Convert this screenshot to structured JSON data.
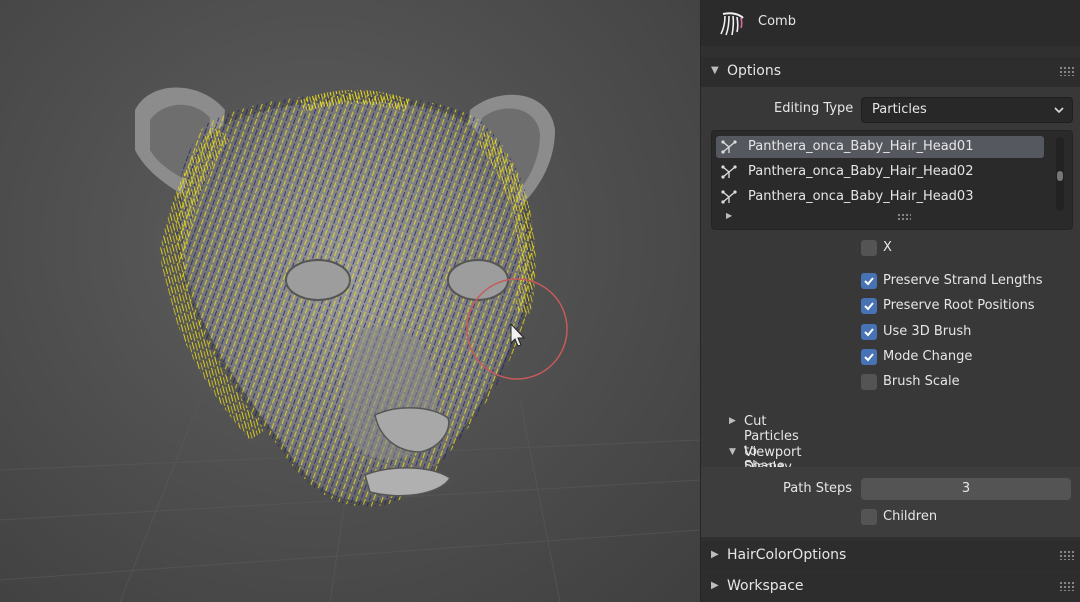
{
  "tool": {
    "name": "Comb",
    "icon": "comb-brush-icon"
  },
  "options": {
    "title": "Options",
    "editing_type": {
      "label": "Editing Type",
      "value": "Particles"
    },
    "particle_systems": [
      {
        "name": "Panthera_onca_Baby_Hair_Head01",
        "active": true
      },
      {
        "name": "Panthera_onca_Baby_Hair_Head02",
        "active": false
      },
      {
        "name": "Panthera_onca_Baby_Hair_Head03",
        "active": false
      }
    ],
    "mirror_x": {
      "label": "X",
      "checked": false
    },
    "checkboxes": [
      {
        "label": "Preserve Strand Lengths",
        "checked": true
      },
      {
        "label": "Preserve Root Positions",
        "checked": true
      },
      {
        "label": "Use 3D Brush",
        "checked": true
      },
      {
        "label": "Mode Change",
        "checked": true
      },
      {
        "label": "Brush Scale",
        "checked": false
      }
    ],
    "cut_particles": {
      "title": "Cut Particles to Shape",
      "expanded": false
    },
    "viewport_display": {
      "title": "Viewport Display",
      "expanded": true,
      "path_steps": {
        "label": "Path Steps",
        "value": "3"
      },
      "children": {
        "label": "Children",
        "checked": false
      }
    }
  },
  "hair_color_options": {
    "title": "HairColorOptions",
    "expanded": false
  },
  "workspace": {
    "title": "Workspace",
    "expanded": false
  },
  "colors": {
    "accent": "#4772b3",
    "hair": "#f2e21a",
    "selection": "#1a1f6e",
    "brush_ring": "#c85a5a"
  }
}
